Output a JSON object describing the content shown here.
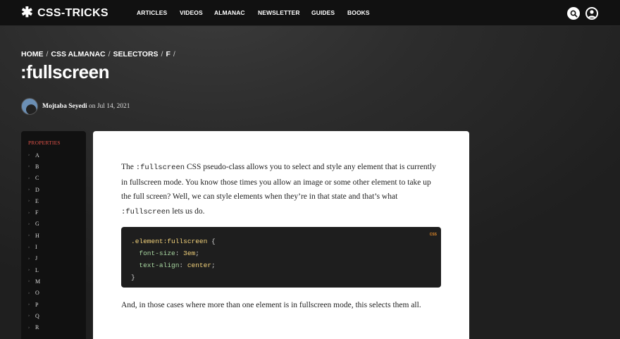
{
  "header": {
    "logo_text": "CSS-TRICKS",
    "nav": [
      "ARTICLES",
      "VIDEOS",
      "ALMANAC",
      "NEWSLETTER",
      "GUIDES",
      "BOOKS"
    ],
    "icons": [
      "search-icon",
      "user-icon"
    ]
  },
  "breadcrumb": [
    "HOME",
    "CSS ALMANAC",
    "SELECTORS",
    "F"
  ],
  "page_title": ":fullscreen",
  "byline": {
    "author": "Mojtaba Seyedi",
    "on": "on",
    "date": "Jul 14, 2021"
  },
  "sidebar": {
    "heading": "PROPERTIES",
    "items": [
      "A",
      "B",
      "C",
      "D",
      "E",
      "F",
      "G",
      "H",
      "I",
      "J",
      "L",
      "M",
      "O",
      "P",
      "Q",
      "R"
    ]
  },
  "article": {
    "p1_a": "The ",
    "p1_code1": ":fullscreen",
    "p1_b": " CSS pseudo-class allows you to select and style any element that is currently in fullscreen mode. You know those times you allow an image or some other element to take up the full screen? Well, we can style elements when they’re in that state and that’s what ",
    "p1_code2": ":fullscreen",
    "p1_c": " lets us do.",
    "code_lang": "CSS",
    "code": {
      "selector": ".element:fullscreen",
      "open": " {",
      "prop1": "font-size",
      "val1": "3em",
      "prop2": "text-align",
      "val2": "center",
      "close": "}"
    },
    "p2": "And, in those cases where more than one element is in fullscreen mode, this selects them all."
  },
  "colors": {
    "header_bg": "#111111",
    "page_bg": "#2c2c2c",
    "sidebar_heading": "#e4544a",
    "code_bg": "#1e1e1e",
    "code_accent": "#f3d27a"
  }
}
